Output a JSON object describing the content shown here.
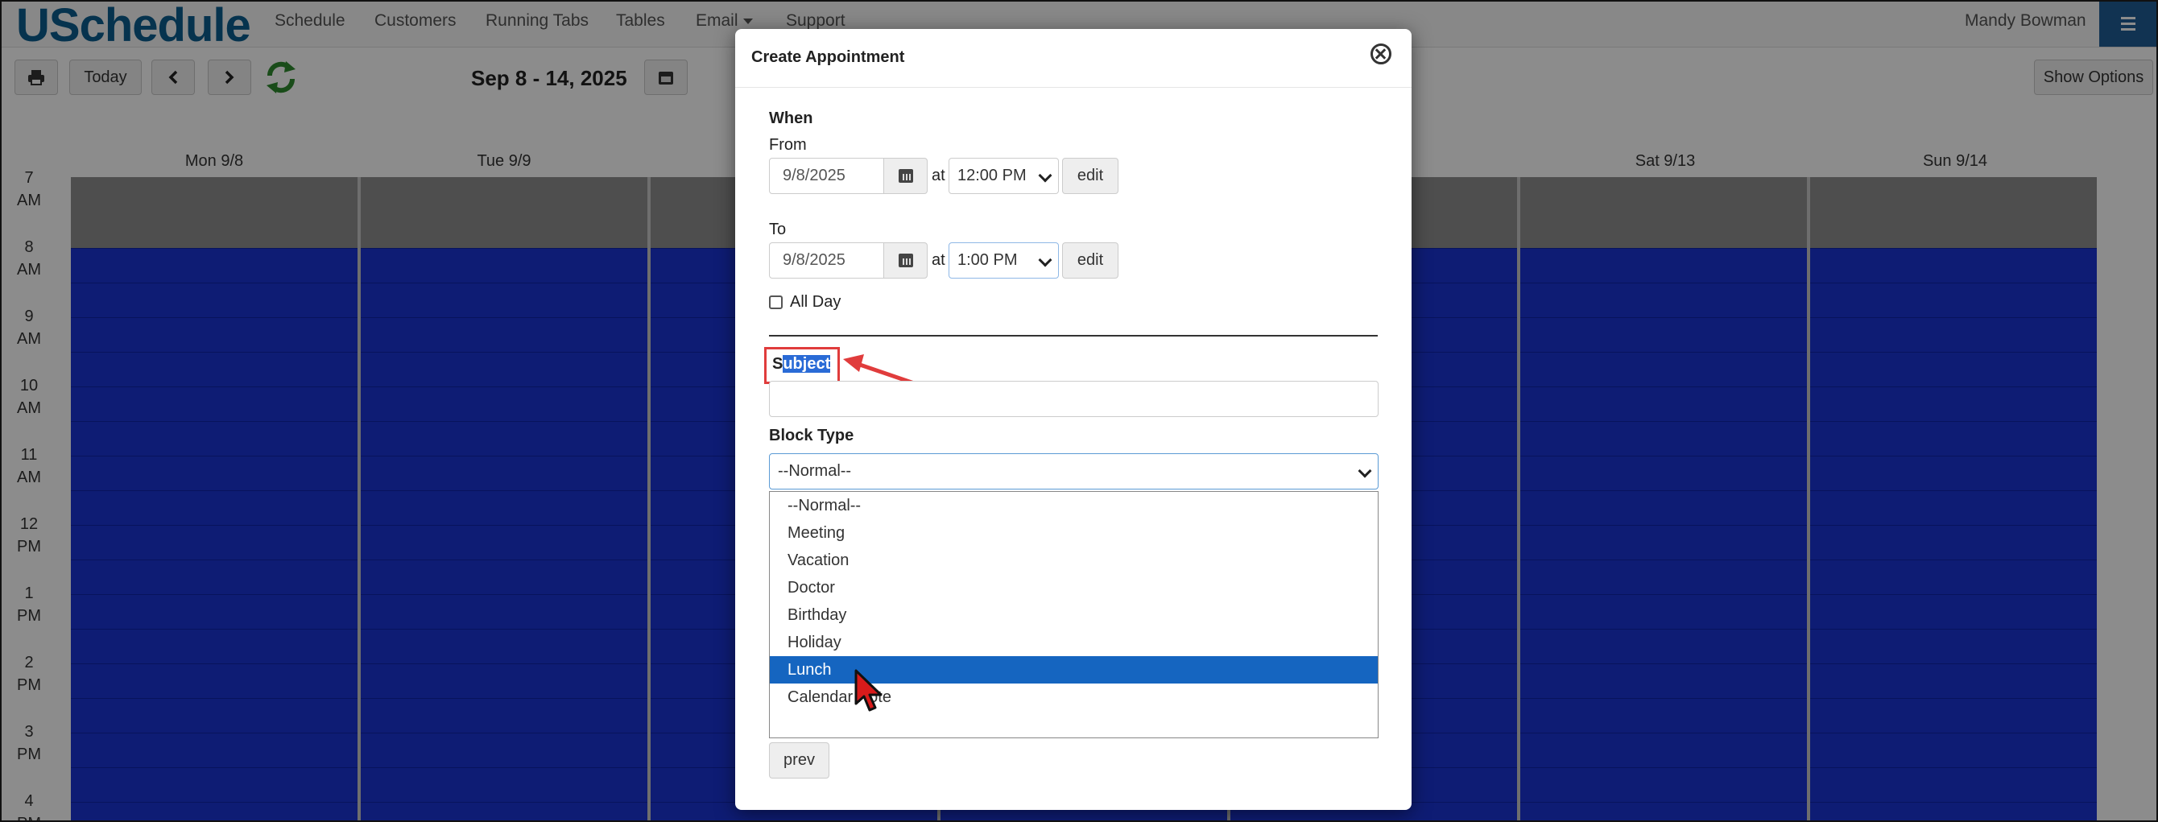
{
  "app": {
    "logo": "USchedule",
    "user_name": "Mandy Bowman"
  },
  "nav": [
    {
      "label": "Schedule"
    },
    {
      "label": "Customers"
    },
    {
      "label": "Running Tabs"
    },
    {
      "label": "Tables"
    },
    {
      "label": "Email"
    },
    {
      "label": "Support"
    }
  ],
  "toolbar": {
    "today_label": "Today",
    "week_label": "Sep 8 - 14, 2025",
    "show_options_label": "Show Options"
  },
  "calendar": {
    "days": [
      "Mon 9/8",
      "Tue 9/9",
      "",
      "",
      "",
      "Sat 9/13",
      "Sun 9/14"
    ],
    "hours": [
      {
        "num": "7",
        "ampm": "AM"
      },
      {
        "num": "8",
        "ampm": "AM"
      },
      {
        "num": "9",
        "ampm": "AM"
      },
      {
        "num": "10",
        "ampm": "AM"
      },
      {
        "num": "11",
        "ampm": "AM"
      },
      {
        "num": "12",
        "ampm": "PM"
      },
      {
        "num": "1",
        "ampm": "PM"
      },
      {
        "num": "2",
        "ampm": "PM"
      },
      {
        "num": "3",
        "ampm": "PM"
      },
      {
        "num": "4",
        "ampm": "PM"
      }
    ],
    "block_color": "#1a34d3"
  },
  "modal": {
    "title": "Create Appointment",
    "when_label": "When",
    "from_label": "From",
    "to_label": "To",
    "at_label": "at",
    "from_date": "9/8/2025",
    "from_time": "12:00 PM",
    "to_date": "9/8/2025",
    "to_time": "1:00 PM",
    "edit_label": "edit",
    "all_day_label": "All Day",
    "subject_label_first": "S",
    "subject_label_rest": "ubject",
    "subject_value": "",
    "block_type_label": "Block Type",
    "block_type_selected": "--Normal--",
    "block_type_options": [
      "--Normal--",
      "Meeting",
      "Vacation",
      "Doctor",
      "Birthday",
      "Holiday",
      "Lunch",
      "Calendar Note"
    ],
    "highlighted_option": "Lunch",
    "prev_label": "prev"
  }
}
